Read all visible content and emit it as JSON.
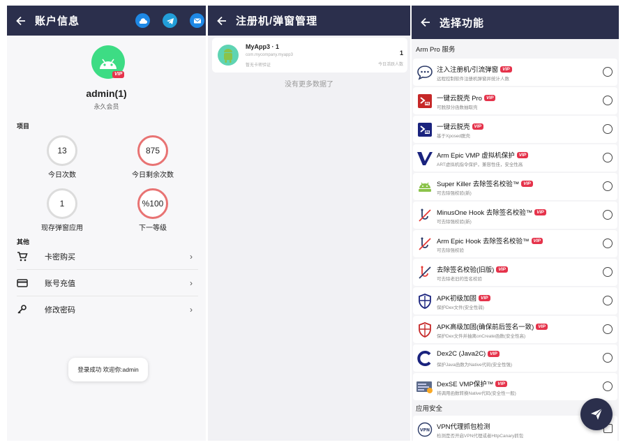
{
  "account": {
    "title": "账户信息",
    "user_name": "admin(1)",
    "user_level": "永久会员",
    "vip_badge": "VIP",
    "section_project": "项目",
    "section_other": "其他",
    "stats": [
      {
        "value": "13",
        "label": "今日次数"
      },
      {
        "value": "875",
        "label": "今日剩余次数"
      },
      {
        "value": "1",
        "label": "现存弹窗应用"
      },
      {
        "value": "%100",
        "label": "下一等级"
      }
    ],
    "menu": [
      {
        "label": "卡密购买",
        "icon": "cart-icon"
      },
      {
        "label": "账号充值",
        "icon": "credit-card-icon"
      },
      {
        "label": "修改密码",
        "icon": "key-icon"
      }
    ],
    "toast": "登录成功 欢迎你:admin",
    "top_icons": [
      "cloud-icon",
      "telegram-icon",
      "mail-icon"
    ],
    "colors": {
      "appbar": "#2b2f4c",
      "accent_blue": "#1e88e5",
      "ring_red": "#e87373",
      "vip": "#e5334b"
    }
  },
  "manager": {
    "title": "注册机/弹窗管理",
    "app": {
      "name": "MyApp3 · 1",
      "package": "com.mycompany.myapp3",
      "desc": "暂无卡密验证",
      "count": "1",
      "count_label": "今日活跃人数"
    },
    "no_more": "没有更多数据了"
  },
  "features": {
    "title": "选择功能",
    "group1": "Arm Pro 服务",
    "group2": "应用安全",
    "items": [
      {
        "name": "注入注册机/引流弹窗",
        "desc": "远程控制软件注册机弹窗并统计人数",
        "vip": "VIP",
        "icon": "chat-bubble-icon"
      },
      {
        "name": "一键云脱壳 Pro",
        "desc": "可脱部分函数抽取壳",
        "vip": "VIP",
        "icon": "unpack-pro-icon"
      },
      {
        "name": "一键云脱壳",
        "desc": "基于Xposed脱壳",
        "vip": "VIP",
        "icon": "unpack-icon"
      },
      {
        "name": "Arm Epic VMP 虚拟机保护",
        "desc": "ART虚拟机指令保护，兼容性佳，安全性高",
        "vip": "VIP",
        "icon": "vmp-v-icon"
      },
      {
        "name": "Super Killer 去除签名校验™",
        "desc": "可去除强校验(新)",
        "vip": "VIP",
        "icon": "android-killer-icon"
      },
      {
        "name": "MinusOne Hook 去除签名校验™",
        "desc": "可去除强校验(新)",
        "vip": "VIP",
        "icon": "hook-icon"
      },
      {
        "name": "Arm Epic Hook 去除签名校验™",
        "desc": "可去除强校验",
        "vip": "VIP",
        "icon": "hook-icon"
      },
      {
        "name": "去除签名校验(旧版)",
        "desc": "可去除老旧的签名校验",
        "vip": "VIP",
        "icon": "hook-red-icon"
      },
      {
        "name": "APK初级加固",
        "desc": "保护Dex文件(安全性弱)",
        "vip": "VIP",
        "icon": "shield-blue-icon"
      },
      {
        "name": "APK高级加固(确保前后签名一致)",
        "desc": "保护Dex文件并抽离onCreate函数(安全性高)",
        "vip": "VIP",
        "icon": "shield-red-icon"
      },
      {
        "name": "Dex2C (Java2C)",
        "desc": "保护Java函数为Native代码(安全性强)",
        "vip": "VIP",
        "icon": "dex2c-icon"
      },
      {
        "name": "DexSE VMP保护™",
        "desc": "将调用函数转换Native代码(安全性一般)",
        "vip": "VIP",
        "icon": "dexse-icon"
      }
    ],
    "vpn": {
      "name": "VPN代理抓包检测",
      "desc": "检测是否开启VPN代理或者HttpCanary抓包",
      "icon": "vpn-icon"
    }
  }
}
